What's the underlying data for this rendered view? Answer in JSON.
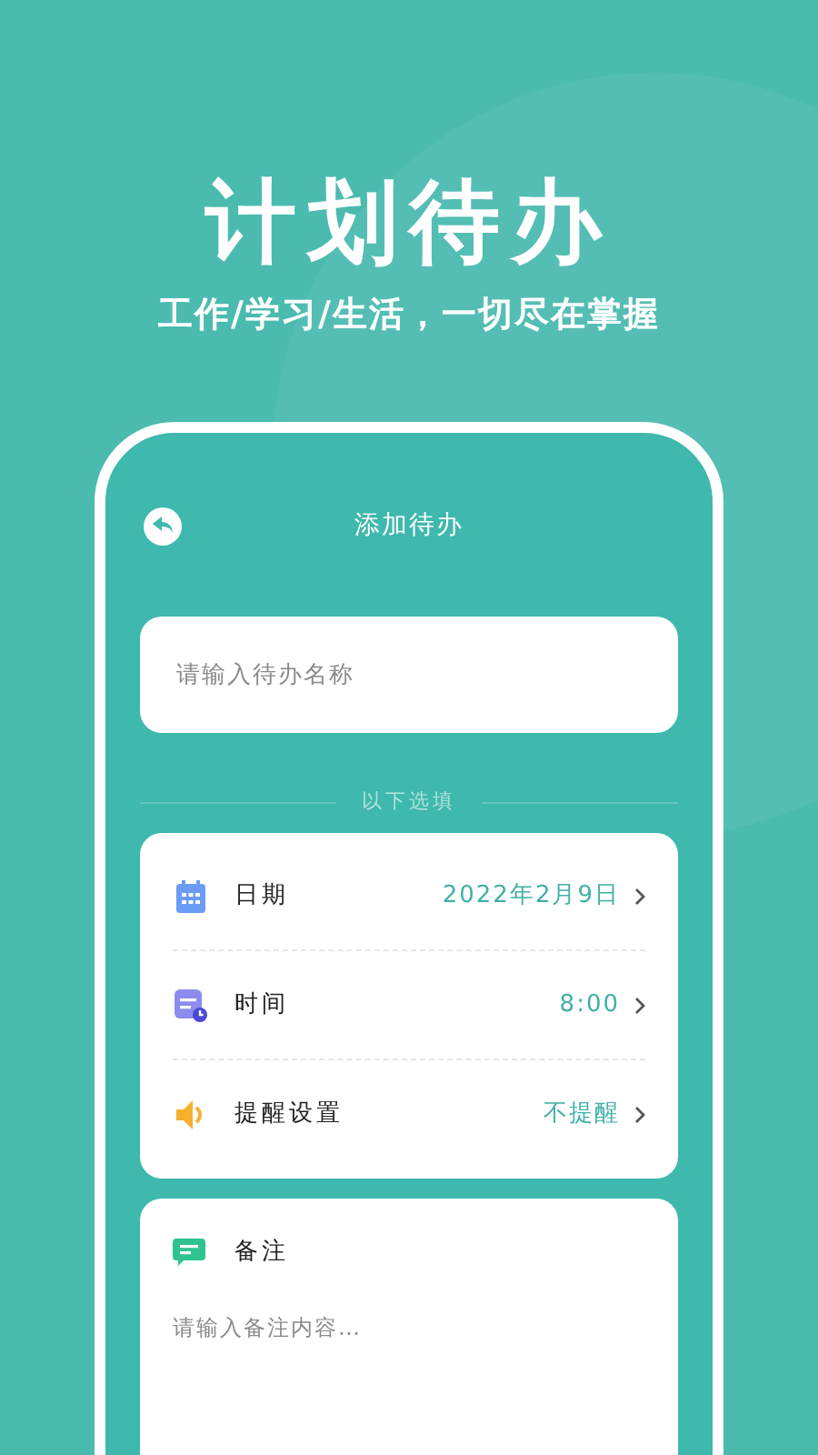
{
  "headline": "计划待办",
  "tagline": "工作/学习/生活，一切尽在掌握",
  "screen": {
    "title": "添加待办",
    "name_field": {
      "placeholder": "请输入待办名称"
    },
    "section_label": "以下选填",
    "options": [
      {
        "label": "日期",
        "value": "2022年2月9日"
      },
      {
        "label": "时间",
        "value": "8:00"
      },
      {
        "label": "提醒设置",
        "value": "不提醒"
      }
    ],
    "note": {
      "label": "备注",
      "placeholder": "请输入备注内容…"
    }
  }
}
